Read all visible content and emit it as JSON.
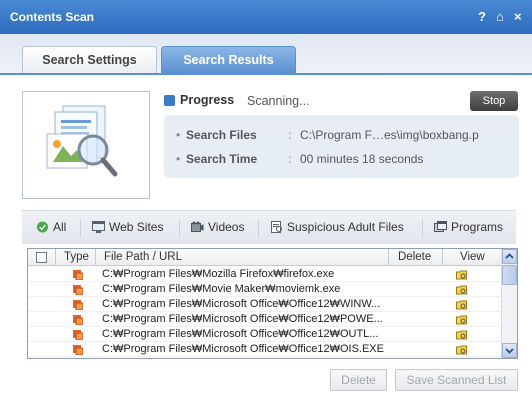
{
  "window": {
    "title": "Contents Scan",
    "help_label": "?",
    "home_label": "⌂",
    "close_label": "×"
  },
  "tabs": [
    {
      "label": "Search Settings",
      "active": false
    },
    {
      "label": "Search Results",
      "active": true
    }
  ],
  "progress": {
    "label": "Progress",
    "status": "Scanning...",
    "stop_label": "Stop",
    "search_files_label": "Search Files",
    "search_files_value": "C:\\Program F…es\\img\\boxbang.p",
    "search_time_label": "Search Time",
    "search_time_value": "00 minutes 18 seconds",
    "colon": ":",
    "bullet": "•"
  },
  "filters": [
    {
      "label": "All",
      "icon": "check-circle-icon"
    },
    {
      "label": "Web Sites",
      "icon": "website-icon"
    },
    {
      "label": "Videos",
      "icon": "video-icon"
    },
    {
      "label": "Suspicious Adult Files",
      "icon": "suspicious-file-icon"
    },
    {
      "label": "Programs",
      "icon": "program-icon"
    }
  ],
  "table": {
    "headers": {
      "type": "Type",
      "path": "File Path / URL",
      "delete": "Delete",
      "view": "View"
    },
    "rows": [
      {
        "path": "C:₩Program Files₩Mozilla Firefox₩firefox.exe"
      },
      {
        "path": "C:₩Program Files₩Movie Maker₩moviemk.exe"
      },
      {
        "path": "C:₩Program Files₩Microsoft Office₩Office12₩WINW..."
      },
      {
        "path": "C:₩Program Files₩Microsoft Office₩Office12₩POWE..."
      },
      {
        "path": "C:₩Program Files₩Microsoft Office₩Office12₩OUTL..."
      },
      {
        "path": "C:₩Program Files₩Microsoft Office₩Office12₩OIS.EXE"
      }
    ]
  },
  "footer": {
    "delete_label": "Delete",
    "save_label": "Save Scanned List"
  },
  "colors": {
    "titlebar": "#2d6bbd",
    "active_tab": "#5a8fd0",
    "type_icon": "#e0632c"
  }
}
